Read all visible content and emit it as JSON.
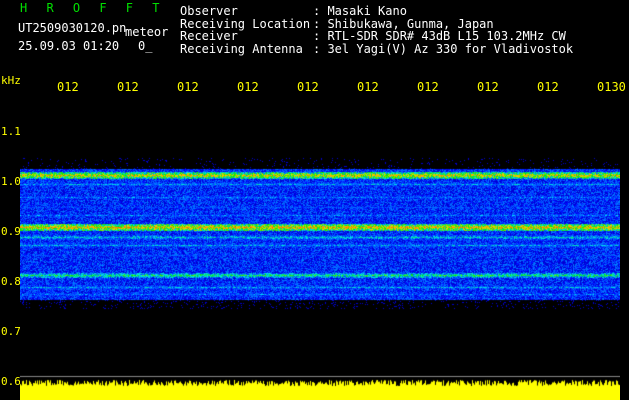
{
  "header": {
    "title": "H R O F F T",
    "filename": "UT2509030120.pn",
    "mode": "meteor",
    "date_time": "25.09.03 01:20",
    "count": "0_"
  },
  "info": {
    "labels": [
      "Observer",
      "Receiving Location",
      "Receiver",
      "Receiving Antenna"
    ],
    "values": [
      ": Masaki Kano",
      ": Shibukawa, Gunma, Japan",
      ": RTL-SDR SDR# 43dB L15 103.2MHz CW",
      ": 3el Yagi(V) Az 330 for Vladivostok"
    ]
  },
  "axis": {
    "unit": "kHz",
    "time_labels": [
      "012",
      "012",
      "012",
      "012",
      "012",
      "012",
      "012",
      "012",
      "012",
      "0130"
    ],
    "freq_labels": [
      "1.1",
      "1.0",
      "0.9",
      "0.8",
      "0.7",
      "0.6"
    ]
  },
  "colors": {
    "bg": "#000000",
    "axis": "#ffff00",
    "title": "#00e000"
  }
}
